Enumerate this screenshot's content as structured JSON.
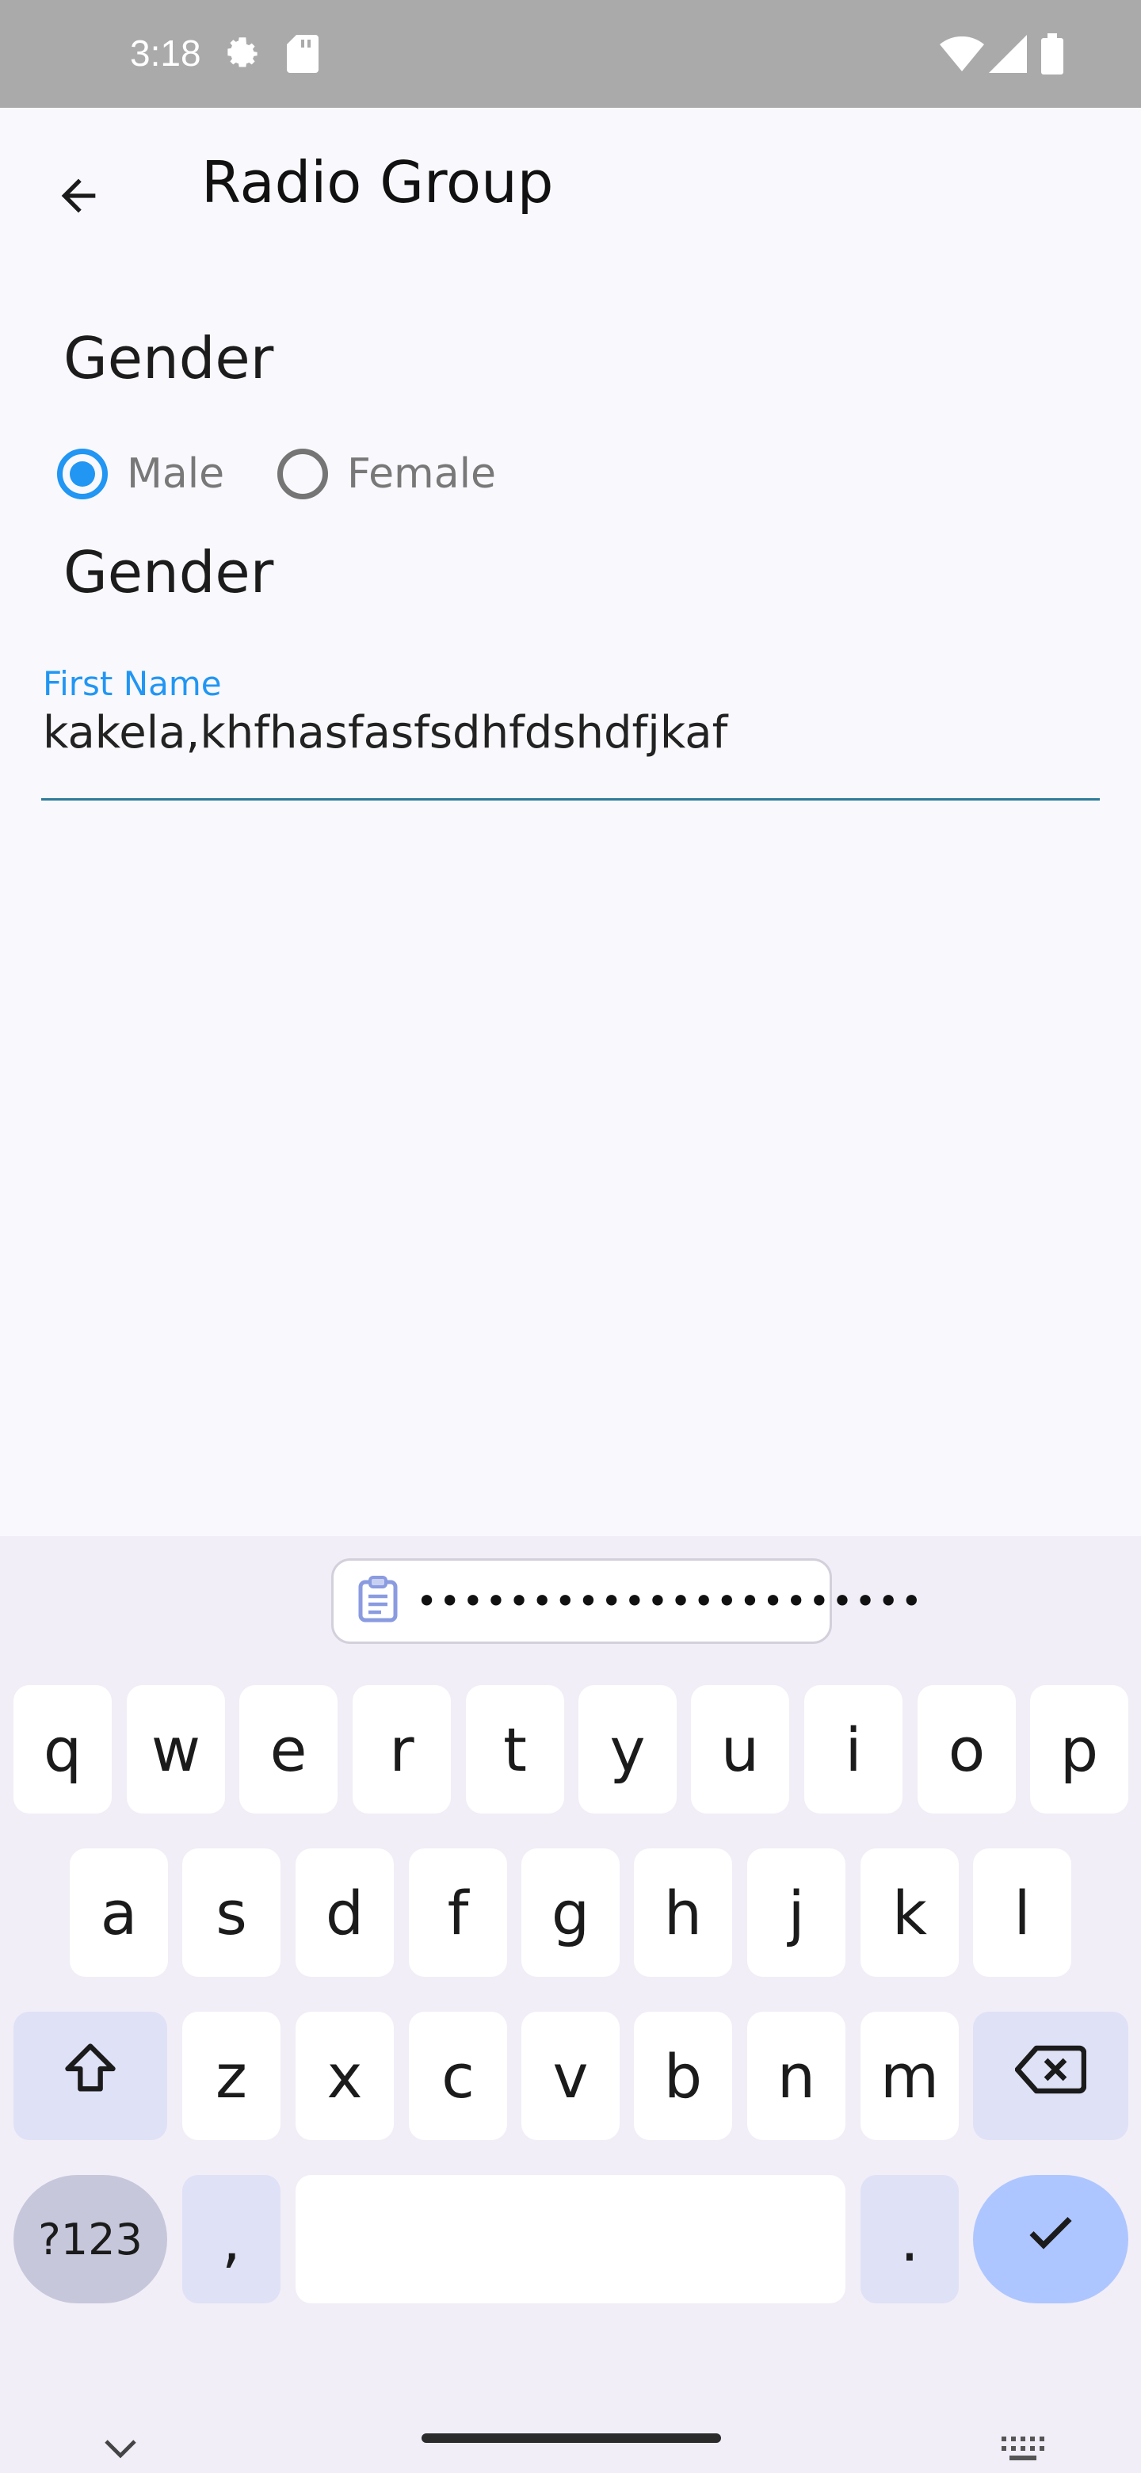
{
  "status_bar": {
    "time": "3:18",
    "icons": [
      "gear-icon",
      "sd-card-icon",
      "wifi-icon",
      "signal-icon",
      "battery-icon"
    ]
  },
  "app_bar": {
    "title": "Radio Group",
    "back_icon": "arrow-back-icon"
  },
  "form": {
    "gender_label_1": "Gender",
    "gender_label_2": "Gender",
    "radio_options": [
      {
        "label": "Male",
        "selected": true
      },
      {
        "label": "Female",
        "selected": false
      }
    ],
    "first_name": {
      "label": "First Name",
      "value": "kakela,khfhasfasfsdhfdshdfjkaf"
    }
  },
  "keyboard": {
    "clipboard_text": "••••••••••••••••••••••",
    "row1": [
      "q",
      "w",
      "e",
      "r",
      "t",
      "y",
      "u",
      "i",
      "o",
      "p"
    ],
    "row2": [
      "a",
      "s",
      "d",
      "f",
      "g",
      "h",
      "j",
      "k",
      "l"
    ],
    "row3": [
      "z",
      "x",
      "c",
      "v",
      "b",
      "n",
      "m"
    ],
    "symbols_label": "?123",
    "comma": ",",
    "period": "."
  },
  "colors": {
    "accent": "#2196f3",
    "status_bar": "#aaaaaa",
    "background": "#f9f8fd",
    "keyboard_bg": "#f1eef7",
    "enter_key": "#aec6ff"
  }
}
